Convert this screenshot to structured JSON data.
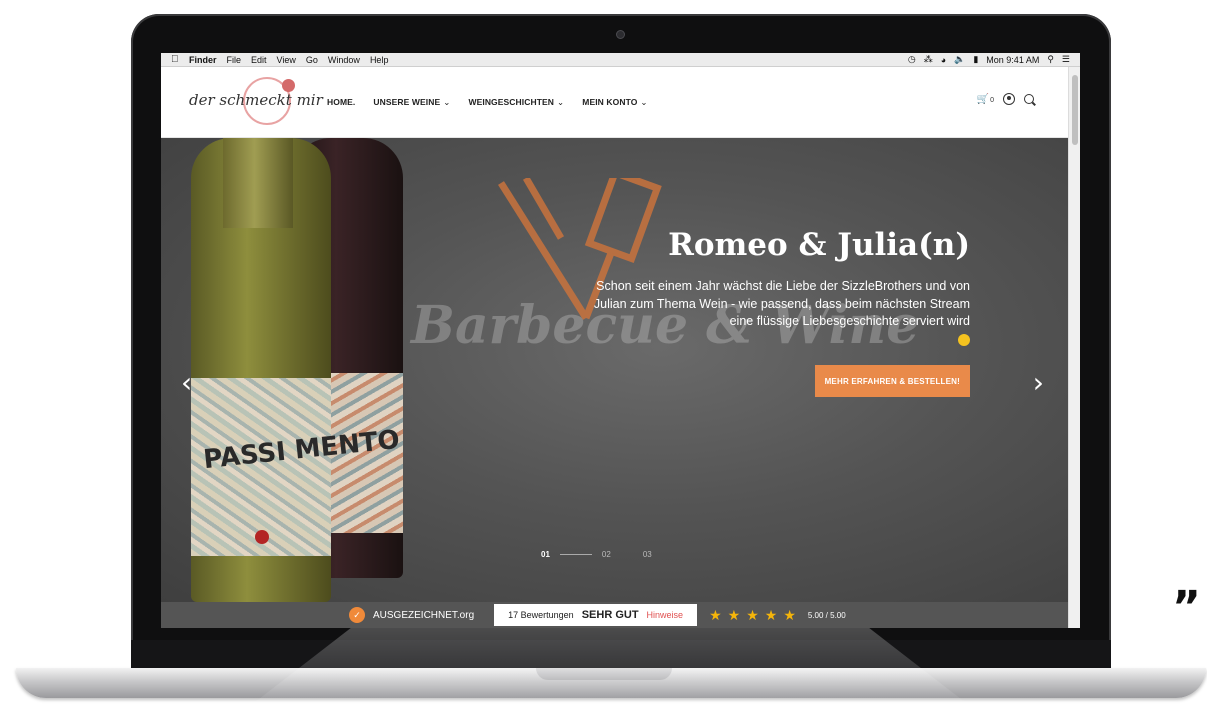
{
  "menubar": {
    "app": "Finder",
    "items": [
      "File",
      "Edit",
      "View",
      "Go",
      "Window",
      "Help"
    ],
    "clock": "Mon 9:41 AM"
  },
  "site": {
    "logo": "der schmeckt mir",
    "nav": [
      {
        "label": "HOME.",
        "has_menu": false
      },
      {
        "label": "UNSERE WEINE",
        "has_menu": true
      },
      {
        "label": "WEINGESCHICHTEN",
        "has_menu": true
      },
      {
        "label": "MEIN KONTO",
        "has_menu": true
      }
    ],
    "cart_count": "0",
    "icons": [
      "cart-icon",
      "account-icon",
      "search-icon"
    ]
  },
  "hero": {
    "bg_text": "Barbecue & Wine",
    "bottle_label": "PASSI MENTO",
    "title": "Romeo & Julia(n)",
    "description": "Schon seit einem Jahr wächst die Liebe der SizzleBrothers und von Julian zum Thema Wein - wie passend, dass beim nächsten Stream eine flüssige Liebesgeschichte serviert wird",
    "cta": "MEHR ERFAHREN & BESTELLEN!",
    "slides": [
      "01",
      "02",
      "03"
    ],
    "active_slide": "01"
  },
  "rating": {
    "provider": "AUSGEZEICHNET.org",
    "count_text": "17 Bewertungen",
    "verdict": "SEHR GUT",
    "link": "Hinweise",
    "stars": 5,
    "score": "5.00 / 5.00"
  },
  "decor": {
    "quote_mark": "”"
  },
  "colors": {
    "accent": "#e98a4a",
    "hero_bg": "#545454",
    "rating_bar": "#555555",
    "star": "#f5b50a"
  }
}
